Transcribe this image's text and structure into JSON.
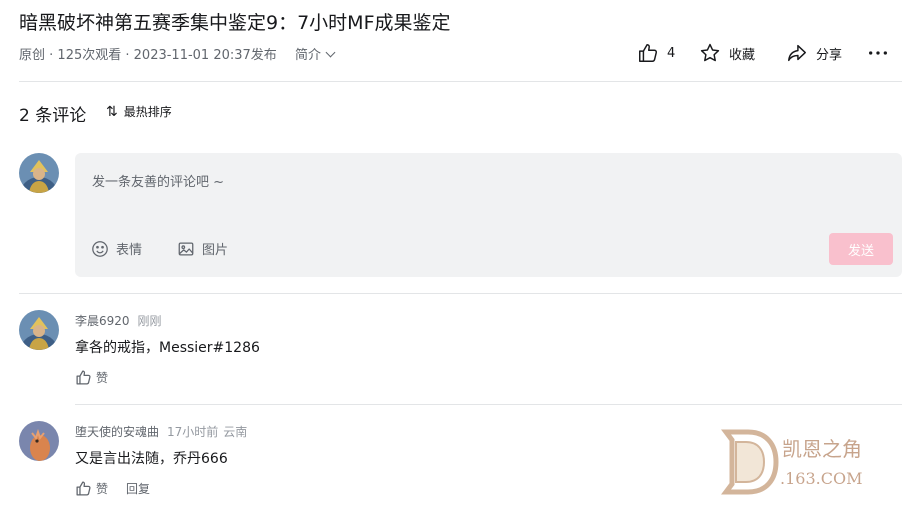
{
  "article": {
    "title": "暗黑破坏神第五赛季集中鉴定9：7小时MF成果鉴定",
    "type": "原创",
    "views": "125次观看",
    "published": "2023-11-01 20:37发布",
    "intro_label": "简介"
  },
  "actions": {
    "like_count": "4",
    "favorite_label": "收藏",
    "share_label": "分享"
  },
  "comments_header": {
    "count_label": "2 条评论",
    "sort_label": "最热排序"
  },
  "editor": {
    "placeholder": "发一条友善的评论吧 ~",
    "emoji_label": "表情",
    "image_label": "图片",
    "send_label": "发送"
  },
  "comments": [
    {
      "user": "李晨6920",
      "time": "刚刚",
      "location": "",
      "text": "拿各的戒指，Messier#1286",
      "like_label": "赞",
      "reply_label": ""
    },
    {
      "user": "堕天使的安魂曲",
      "time": "17小时前",
      "location": "云南",
      "text": "又是言出法随，乔丹666",
      "like_label": "赞",
      "reply_label": "回复"
    }
  ],
  "watermark": {
    "logo_text": "凯恩之角",
    "domain_text": ".163.COM"
  },
  "colors": {
    "accent_pink": "#f9c0cd",
    "text_primary": "#18191c",
    "text_secondary": "#61666d",
    "text_muted": "#9499a0",
    "divider": "#e3e5e7",
    "editor_bg": "#f1f2f3"
  }
}
